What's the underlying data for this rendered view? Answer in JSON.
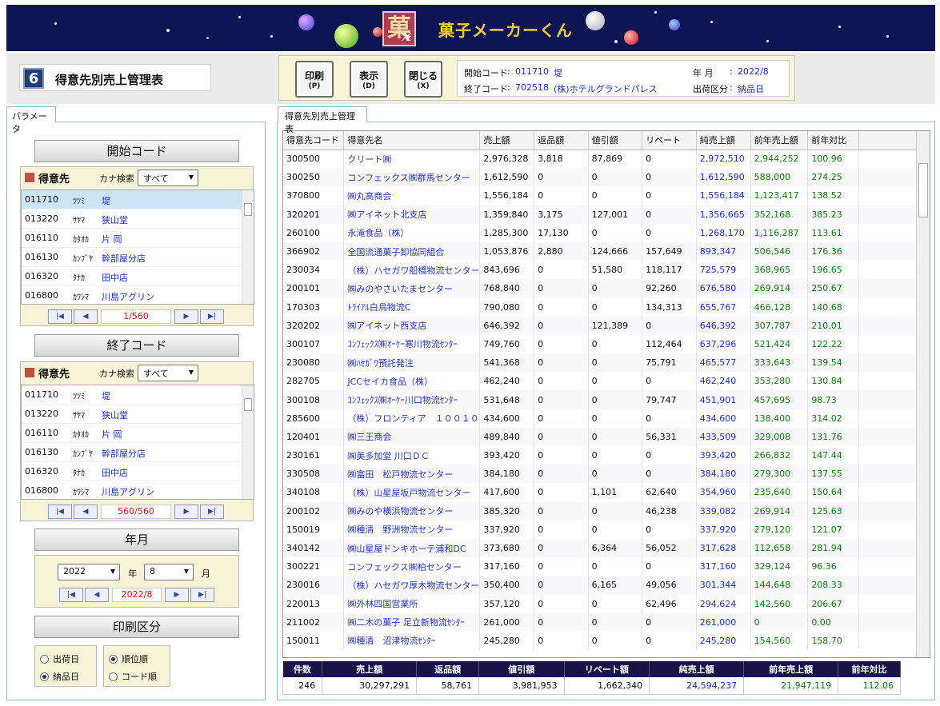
{
  "app": {
    "title": "菓子メーカーくん",
    "logo_char": "菓",
    "logo_mark": "x"
  },
  "screen": {
    "number": "6",
    "title": "得意先別売上管理表"
  },
  "buttons": [
    {
      "label": "印刷",
      "key": "(P)"
    },
    {
      "label": "表示",
      "key": "(D)"
    },
    {
      "label": "閉じる",
      "key": "(X)"
    }
  ],
  "conditions": {
    "start_label": "開始コード",
    "start_code": "011710",
    "start_name": "堤",
    "end_label": "終了コード",
    "end_code": "702518",
    "end_name": "(株)ホテルグランドパレス",
    "ym_label": "年 月",
    "ym_value": "2022/8",
    "ship_label": "出荷区分",
    "ship_value": "納品日",
    "sep": ":"
  },
  "left": {
    "tab": "パラメータ",
    "start": {
      "heading": "開始コード",
      "picker": "得意先",
      "kana_label": "カナ検索",
      "kana_value": "すべて",
      "rows": [
        {
          "code": "011710",
          "kana": "ﾂﾂﾐ",
          "name": "堤"
        },
        {
          "code": "013220",
          "kana": "ｻﾔﾏ",
          "name": "狭山堂"
        },
        {
          "code": "016110",
          "kana": "ｶﾀｵｶ",
          "name": "片 岡"
        },
        {
          "code": "016130",
          "kana": "ｶﾝﾌﾞﾔ",
          "name": "幹部屋分店"
        },
        {
          "code": "016320",
          "kana": "ﾀﾅｶ",
          "name": "田中店"
        },
        {
          "code": "016800",
          "kana": "ｶﾜｼﾏ",
          "name": "川島アグリン"
        }
      ],
      "count": "1/560"
    },
    "end": {
      "heading": "終了コード",
      "picker": "得意先",
      "kana_label": "カナ検索",
      "kana_value": "すべて",
      "rows": [
        {
          "code": "011710",
          "kana": "ﾂﾂﾐ",
          "name": "堤"
        },
        {
          "code": "013220",
          "kana": "ｻﾔﾏ",
          "name": "狭山堂"
        },
        {
          "code": "016110",
          "kana": "ｶﾀｵｶ",
          "name": "片 岡"
        },
        {
          "code": "016130",
          "kana": "ｶﾝﾌﾞﾔ",
          "name": "幹部屋分店"
        },
        {
          "code": "016320",
          "kana": "ﾀﾅｶ",
          "name": "田中店"
        },
        {
          "code": "016800",
          "kana": "ｶﾜｼﾏ",
          "name": "川島アグリン"
        }
      ],
      "count": "560/560"
    },
    "ym": {
      "heading": "年月",
      "year": "2022",
      "year_unit": "年",
      "month": "8",
      "month_unit": "月",
      "display": "2022/8"
    },
    "print_kbn": {
      "heading": "印刷区分",
      "ship_options": [
        "出荷日",
        "納品日"
      ],
      "ship_selected": 1,
      "order_options": [
        "順位順",
        "コード順"
      ],
      "order_selected": 0
    }
  },
  "main": {
    "tab": "得意先別売上管理表",
    "columns": [
      "得意先コード",
      "得意先名",
      "売上額",
      "返品額",
      "値引額",
      "リベート",
      "純売上額",
      "前年売上額",
      "前年対比"
    ],
    "rows": [
      [
        "300500",
        "クリート㈱",
        "2,976,328",
        "3,818",
        "87,869",
        "0",
        "2,972,510",
        "2,944,252",
        "100.96"
      ],
      [
        "300250",
        "コンフェックス㈱群馬センター",
        "1,612,590",
        "0",
        "0",
        "0",
        "1,612,590",
        "588,000",
        "274.25"
      ],
      [
        "370800",
        "㈱丸高商会",
        "1,556,184",
        "0",
        "0",
        "0",
        "1,556,184",
        "1,123,417",
        "138.52"
      ],
      [
        "320201",
        "㈱アイネット北支店",
        "1,359,840",
        "3,175",
        "127,001",
        "0",
        "1,356,665",
        "352,168",
        "385.23"
      ],
      [
        "260100",
        "永滝食品（株）",
        "1,285,300",
        "17,130",
        "0",
        "0",
        "1,268,170",
        "1,116,287",
        "113.61"
      ],
      [
        "366902",
        "全国流通菓子卸協同組合",
        "1,053,876",
        "2,880",
        "124,666",
        "157,649",
        "893,347",
        "506,546",
        "176.36"
      ],
      [
        "230034",
        "（株）ハセガワ船橋物流センター",
        "843,696",
        "0",
        "51,580",
        "118,117",
        "725,579",
        "368,965",
        "196.65"
      ],
      [
        "200101",
        "㈱みのやさいたまセンター",
        "768,840",
        "0",
        "0",
        "92,260",
        "676,580",
        "269,914",
        "250.67"
      ],
      [
        "170303",
        "ﾄﾗｲｱﾙ白鳥物流C",
        "790,080",
        "0",
        "0",
        "134,313",
        "655,767",
        "466,128",
        "140.68"
      ],
      [
        "320202",
        "㈱アイネット西支店",
        "646,392",
        "0",
        "121,389",
        "0",
        "646,392",
        "307,787",
        "210.01"
      ],
      [
        "300107",
        "ｺﾝﾌｪｯｸｽ㈱ｵｰｹｰ寒川物流ｾﾝﾀｰ",
        "749,760",
        "0",
        "0",
        "112,464",
        "637,296",
        "521,424",
        "122.22"
      ],
      [
        "230080",
        "㈱ﾊｾｶﾞﾜ預託発注",
        "541,368",
        "0",
        "0",
        "75,791",
        "465,577",
        "333,643",
        "139.54"
      ],
      [
        "282705",
        "JCCセイカ食品（株）",
        "462,240",
        "0",
        "0",
        "0",
        "462,240",
        "353,280",
        "130.84"
      ],
      [
        "300108",
        "ｺﾝﾌｪｯｸｽ㈱ｵｰｹｰ川口物流ｾﾝﾀｰ",
        "531,648",
        "0",
        "0",
        "79,747",
        "451,901",
        "457,695",
        "98.73"
      ],
      [
        "285600",
        "（株）フロンティア　１００１０",
        "434,600",
        "0",
        "0",
        "0",
        "434,600",
        "138,400",
        "314.02"
      ],
      [
        "120401",
        "㈱三王商会",
        "489,840",
        "0",
        "0",
        "56,331",
        "433,509",
        "329,008",
        "131.76"
      ],
      [
        "230161",
        "㈱美多加堂 川口ＤＣ",
        "393,420",
        "0",
        "0",
        "0",
        "393,420",
        "266,832",
        "147.44"
      ],
      [
        "330508",
        "㈱富田　松戸物流センター",
        "384,180",
        "0",
        "0",
        "0",
        "384,180",
        "279,300",
        "137.55"
      ],
      [
        "340108",
        "（株）山星屋坂戸物流センター",
        "417,600",
        "0",
        "1,101",
        "62,640",
        "354,960",
        "235,640",
        "150.64"
      ],
      [
        "200102",
        "㈱みのや横浜物流センター",
        "385,320",
        "0",
        "0",
        "46,238",
        "339,082",
        "269,914",
        "125.63"
      ],
      [
        "150019",
        "㈱種清　野洲物流センター",
        "337,920",
        "0",
        "0",
        "0",
        "337,920",
        "279,120",
        "121.07"
      ],
      [
        "340142",
        "㈱山星屋ドンキホーテ浦和DC",
        "373,680",
        "0",
        "6,364",
        "56,052",
        "317,628",
        "112,658",
        "281.94"
      ],
      [
        "300221",
        "コンフェックス㈱柏センター",
        "317,160",
        "0",
        "0",
        "0",
        "317,160",
        "329,124",
        "96.36"
      ],
      [
        "230016",
        "（株）ハセガワ厚木物流センター",
        "350,400",
        "0",
        "6,165",
        "49,056",
        "301,344",
        "144,648",
        "208.33"
      ],
      [
        "220013",
        "㈱外林四国営業所",
        "357,120",
        "0",
        "0",
        "62,496",
        "294,624",
        "142,560",
        "206.67"
      ],
      [
        "211002",
        "㈱二木の菓子 足立新物流ｾﾝﾀｰ",
        "261,000",
        "0",
        "0",
        "0",
        "261,000",
        "0",
        "0.00"
      ],
      [
        "150011",
        "㈱種清　沼津物流ｾﾝﾀｰ",
        "245,280",
        "0",
        "0",
        "0",
        "245,280",
        "154,560",
        "158.70"
      ]
    ],
    "totals_headers": [
      "件数",
      "売上額",
      "返品額",
      "値引額",
      "リベート額",
      "純売上額",
      "前年売上額",
      "前年対比"
    ],
    "totals": [
      "246",
      "30,297,291",
      "58,761",
      "3,981,953",
      "1,662,340",
      "24,594,237",
      "21,947,119",
      "112.06"
    ]
  },
  "colors": {
    "banner": "#0e1555",
    "title": "#f2cf2a",
    "link": "#1a2fd0",
    "positive": "#11780f",
    "total_header": "#1a1446",
    "count": "#d21818"
  },
  "icons": {
    "nav": [
      "first-icon",
      "prev-icon",
      "next-icon",
      "last-icon"
    ]
  }
}
